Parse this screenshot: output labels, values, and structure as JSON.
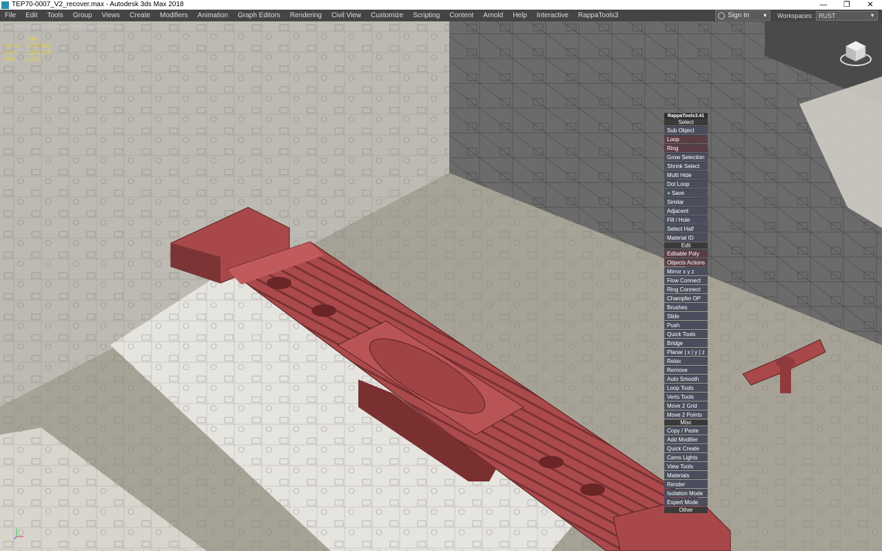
{
  "titlebar": {
    "title": "TEP70-0007_V2_recover.max - Autodesk 3ds Max 2018",
    "minimize": "—",
    "maximize": "❐",
    "close": "✕"
  },
  "menubar": {
    "items": [
      "File",
      "Edit",
      "Tools",
      "Group",
      "Views",
      "Create",
      "Modifiers",
      "Animation",
      "Graph Editors",
      "Rendering",
      "Civil View",
      "Customize",
      "Scripting",
      "Content",
      "Arnold",
      "Help",
      "Interactive",
      "RappaTools3"
    ],
    "signin_label": "Sign In",
    "workspaces_label": "Workspaces:",
    "workspaces_value": "RUST"
  },
  "viewport": {
    "label": "[+] [Orthographic] [User Defined] [Edged Faces]",
    "stats": [
      {
        "key": "",
        "value": "Total"
      },
      {
        "key": "Polys:",
        "value": "2,097,660"
      },
      {
        "key": "Verts:",
        "value": "2,103,418"
      },
      {
        "key": "",
        "value": ""
      },
      {
        "key": "FPS:",
        "value": "5.005"
      }
    ]
  },
  "rappa": {
    "title": "RappaTools3.41",
    "sections": [
      {
        "name": "Select",
        "buttons": [
          "Sub Object",
          "Loop",
          "Ring",
          "Grow Selection",
          "Shrink Select",
          "Multi Hide",
          "Dot Loop",
          "+ Save",
          "Similar",
          "Adjacent",
          "Fill / Hole",
          "Select Half",
          "Material ID"
        ]
      },
      {
        "name": "Edit",
        "buttons": [
          "Editable Poly",
          "Objects Actions",
          "Mirror   x  y  z",
          "Flow Connect",
          "Ring Connect",
          "Champfer OP",
          "Brushes",
          "Slide",
          "Push",
          "Quick Tools",
          "Bridge",
          "Planar | x | y | z",
          "Relax",
          "Remove",
          "Auto Smooth",
          "Loop Tools",
          "Verts Tools",
          "Move 2 Grid",
          "Move 2 Points"
        ]
      },
      {
        "name": "Misc",
        "buttons": [
          "Copy / Paste",
          "Add Modifier",
          "Quick Create",
          "Cams Lights",
          "View Tools",
          "Materials",
          "Render",
          "Isolation Mode",
          "Expert Mode"
        ]
      },
      {
        "name": "Other",
        "buttons": []
      }
    ]
  },
  "colors": {
    "model_red": "#a8484a",
    "model_dark": "#6e2b2d",
    "button_blue": "#4a4e5c",
    "button_red": "#5a3d44"
  },
  "icons": [
    "app-icon",
    "user-icon",
    "viewcube-icon",
    "axis-tripod-icon"
  ]
}
